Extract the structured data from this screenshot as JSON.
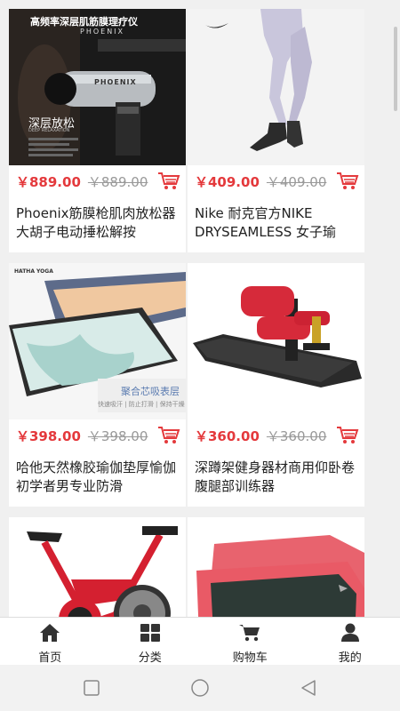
{
  "products": [
    {
      "price": "￥889.00",
      "old_price": "￥889.00",
      "title": "Phoenix筋膜枪肌肉放松器大胡子电动捶松解按",
      "image": {
        "headline": "高频率深层肌筋膜理疗仪",
        "brand": "PHOENIX",
        "tag": "深层放松",
        "tag_sub": "DEEP RELAXATION"
      }
    },
    {
      "price": "￥409.00",
      "old_price": "￥409.00",
      "title": "Nike 耐克官方NIKE DRYSEAMLESS 女子瑜"
    },
    {
      "price": "￥398.00",
      "old_price": "￥398.00",
      "title": "哈他天然橡胶瑜伽垫厚愉伽初学者男专业防滑",
      "image": {
        "logo": "HATHA YOGA",
        "banner": "聚合芯吸表层",
        "banner_sub": "快速吸汗 | 防止打滑 | 保持干燥"
      }
    },
    {
      "price": "￥360.00",
      "old_price": "￥360.00",
      "title": "深蹲架健身器材商用仰卧卷腹腿部训练器"
    },
    {
      "price": "",
      "old_price": "",
      "title": ""
    },
    {
      "price": "",
      "old_price": "",
      "title": ""
    }
  ],
  "tabbar": [
    {
      "label": "首页",
      "icon": "home-icon"
    },
    {
      "label": "分类",
      "icon": "grid-icon"
    },
    {
      "label": "购物车",
      "icon": "cart-icon"
    },
    {
      "label": "我的",
      "icon": "user-icon"
    }
  ],
  "colors": {
    "price": "#e4393c",
    "cart_icon": "#e4393c"
  }
}
